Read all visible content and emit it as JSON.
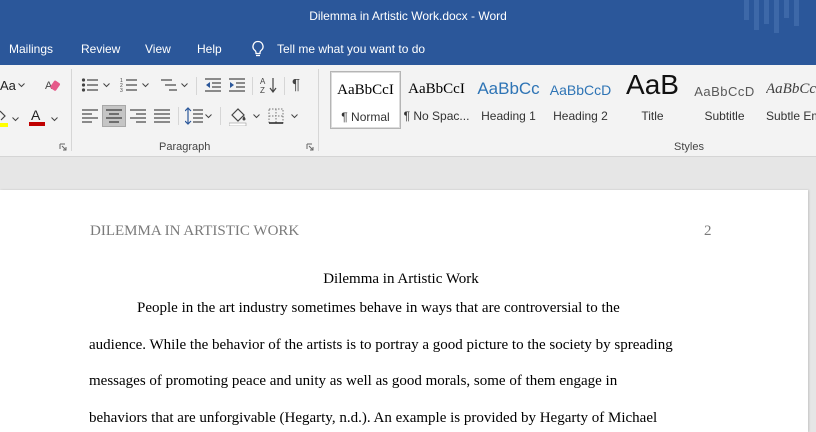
{
  "window": {
    "title": "Dilemma in Artistic Work.docx  -  Word"
  },
  "tabs": [
    {
      "label": "Mailings"
    },
    {
      "label": "Review"
    },
    {
      "label": "View"
    },
    {
      "label": "Help"
    }
  ],
  "tell_me": {
    "placeholder": "Tell me what you want to do",
    "icon": "lightbulb-icon"
  },
  "ribbon": {
    "font_partial": {
      "change_case_label": "Aa"
    },
    "paragraph": {
      "label": "Paragraph"
    },
    "styles": {
      "label": "Styles",
      "items": [
        {
          "preview": "AaBbCcI",
          "name": "¶ Normal",
          "selected": true
        },
        {
          "preview": "AaBbCcI",
          "name": "¶ No Spac..."
        },
        {
          "preview": "AaBbCc",
          "name": "Heading 1"
        },
        {
          "preview": "AaBbCcD",
          "name": "Heading 2"
        },
        {
          "preview": "AaB",
          "name": "Title"
        },
        {
          "preview": "AaBbCcD",
          "name": "Subtitle"
        },
        {
          "preview": "AaBbCcD",
          "name": "Subtle Em"
        }
      ]
    }
  },
  "colors": {
    "brand": "#2b579a",
    "font_color": "#c00000",
    "highlight": "#ffff00"
  },
  "document": {
    "header": "DILEMMA IN ARTISTIC WORK",
    "page_number": "2",
    "title": "Dilemma in Artistic Work",
    "lines": [
      "People in the art industry sometimes behave in ways that are controversial to the",
      "audience. While the behavior of the artists is to portray a good picture to the society by spreading",
      "messages of promoting peace and unity as well as good morals, some of them engage in",
      "behaviors that are unforgivable (Hegarty, n.d.). An example is provided by Hegarty of Michael"
    ]
  }
}
